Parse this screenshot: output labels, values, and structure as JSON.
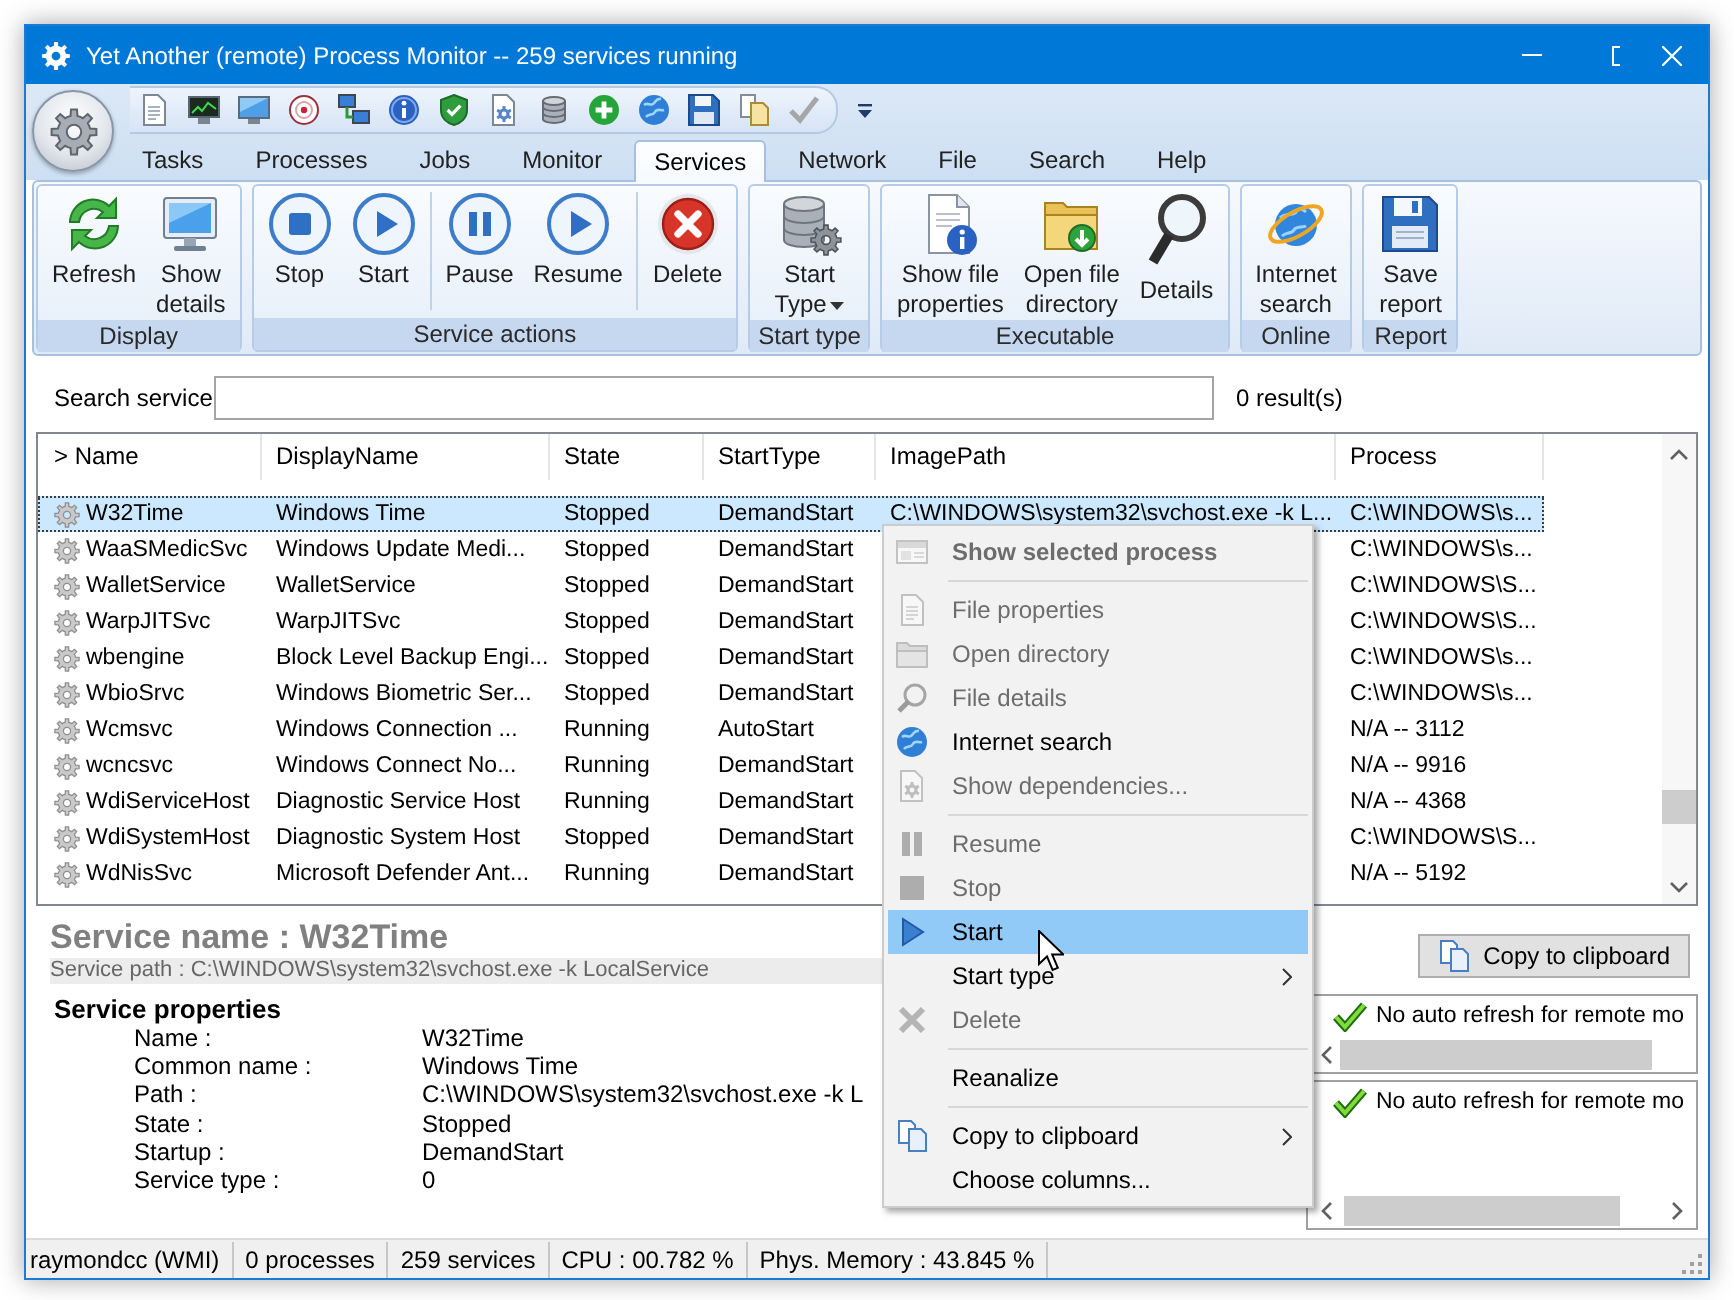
{
  "window": {
    "title": "Yet Another (remote) Process Monitor -- 259 services running"
  },
  "ribbon": {
    "tabs": [
      {
        "label": "Tasks",
        "selected": false
      },
      {
        "label": "Processes",
        "selected": false
      },
      {
        "label": "Jobs",
        "selected": false
      },
      {
        "label": "Monitor",
        "selected": false
      },
      {
        "label": "Services",
        "selected": true
      },
      {
        "label": "Network",
        "selected": false
      },
      {
        "label": "File",
        "selected": false
      },
      {
        "label": "Search",
        "selected": false
      },
      {
        "label": "Help",
        "selected": false
      }
    ],
    "groups": [
      {
        "label": "Display",
        "sections": [
          {
            "buttons": [
              {
                "label": "Refresh",
                "dropdown": false
              },
              {
                "label": "Show\ndetails",
                "dropdown": false
              }
            ]
          }
        ]
      },
      {
        "label": "Service actions",
        "sections": [
          {
            "buttons": [
              {
                "label": "Stop",
                "dropdown": false
              },
              {
                "label": "Start",
                "dropdown": false
              }
            ]
          },
          {
            "buttons": [
              {
                "label": "Pause",
                "dropdown": false
              },
              {
                "label": "Resume",
                "dropdown": false
              }
            ]
          },
          {
            "buttons": [
              {
                "label": "Delete",
                "dropdown": false
              }
            ]
          }
        ]
      },
      {
        "label": "Start type",
        "sections": [
          {
            "buttons": [
              {
                "label": "Start\nType",
                "dropdown": true
              }
            ]
          }
        ]
      },
      {
        "label": "Executable",
        "sections": [
          {
            "buttons": [
              {
                "label": "Show file\nproperties",
                "dropdown": false
              },
              {
                "label": "Open file\ndirectory",
                "dropdown": false
              },
              {
                "label": "Details",
                "dropdown": false
              }
            ]
          }
        ]
      },
      {
        "label": "Online",
        "sections": [
          {
            "buttons": [
              {
                "label": "Internet\nsearch",
                "dropdown": false
              }
            ]
          }
        ]
      },
      {
        "label": "Report",
        "sections": [
          {
            "buttons": [
              {
                "label": "Save\nreport",
                "dropdown": false
              }
            ]
          }
        ]
      }
    ]
  },
  "search": {
    "label": "Search service",
    "result_count": "0 result(s)"
  },
  "table": {
    "columns": [
      "> Name",
      "DisplayName",
      "State",
      "StartType",
      "ImagePath",
      "Process"
    ],
    "rows": [
      {
        "name": "W32Time",
        "display_name": "Windows Time",
        "state": "Stopped",
        "start_type": "DemandStart",
        "image_path": "C:\\WINDOWS\\system32\\svchost.exe -k L...",
        "process": "C:\\WINDOWS\\s...",
        "selected": true
      },
      {
        "name": "WaaSMedicSvc",
        "display_name": "Windows Update Medi...",
        "state": "Stopped",
        "start_type": "DemandStart",
        "process": "C:\\WINDOWS\\s...",
        "selected": false
      },
      {
        "name": "WalletService",
        "display_name": "WalletService",
        "state": "Stopped",
        "start_type": "DemandStart",
        "process": "C:\\WINDOWS\\S...",
        "selected": false
      },
      {
        "name": "WarpJITSvc",
        "display_name": "WarpJITSvc",
        "state": "Stopped",
        "start_type": "DemandStart",
        "process": "C:\\WINDOWS\\S...",
        "selected": false
      },
      {
        "name": "wbengine",
        "display_name": "Block Level Backup Engi...",
        "state": "Stopped",
        "start_type": "DemandStart",
        "process": "C:\\WINDOWS\\s...",
        "selected": false
      },
      {
        "name": "WbioSrvc",
        "display_name": "Windows Biometric Ser...",
        "state": "Stopped",
        "start_type": "DemandStart",
        "process": "C:\\WINDOWS\\s...",
        "selected": false
      },
      {
        "name": "Wcmsvc",
        "display_name": "Windows Connection ...",
        "state": "Running",
        "start_type": "AutoStart",
        "process": "N/A -- 3112",
        "selected": false
      },
      {
        "name": "wcncsvc",
        "display_name": "Windows Connect No...",
        "state": "Running",
        "start_type": "DemandStart",
        "process": "N/A -- 9916",
        "selected": false
      },
      {
        "name": "WdiServiceHost",
        "display_name": "Diagnostic Service Host",
        "state": "Running",
        "start_type": "DemandStart",
        "process": "N/A -- 4368",
        "selected": false
      },
      {
        "name": "WdiSystemHost",
        "display_name": "Diagnostic System Host",
        "state": "Stopped",
        "start_type": "DemandStart",
        "process": "C:\\WINDOWS\\S...",
        "selected": false
      },
      {
        "name": "WdNisSvc",
        "display_name": "Microsoft Defender Ant...",
        "state": "Running",
        "start_type": "DemandStart",
        "process": "N/A -- 5192",
        "selected": false
      }
    ]
  },
  "context_menu": {
    "sections": [
      {
        "items": [
          {
            "label": "Show selected process",
            "default": true,
            "disabled": true,
            "selected": false,
            "submenu": false
          }
        ]
      },
      {
        "items": [
          {
            "label": "File properties",
            "default": false,
            "disabled": true,
            "selected": false,
            "submenu": false
          },
          {
            "label": "Open directory",
            "default": false,
            "disabled": true,
            "selected": false,
            "submenu": false
          },
          {
            "label": "File details",
            "default": false,
            "disabled": true,
            "selected": false,
            "submenu": false
          },
          {
            "label": "Internet search",
            "default": false,
            "disabled": false,
            "selected": false,
            "submenu": false
          },
          {
            "label": "Show dependencies...",
            "default": false,
            "disabled": true,
            "selected": false,
            "submenu": false
          }
        ]
      },
      {
        "items": [
          {
            "label": "Resume",
            "default": false,
            "disabled": true,
            "selected": false,
            "submenu": false
          },
          {
            "label": "Stop",
            "default": false,
            "disabled": true,
            "selected": false,
            "submenu": false
          },
          {
            "label": "Start",
            "default": false,
            "disabled": false,
            "selected": true,
            "submenu": false
          },
          {
            "label": "Start type",
            "default": false,
            "disabled": false,
            "selected": false,
            "submenu": true
          },
          {
            "label": "Delete",
            "default": false,
            "disabled": true,
            "selected": false,
            "submenu": false
          }
        ]
      },
      {
        "items": [
          {
            "label": "Reanalize",
            "default": false,
            "disabled": false,
            "selected": false,
            "submenu": false
          }
        ]
      },
      {
        "items": [
          {
            "label": "Copy to clipboard",
            "default": false,
            "disabled": false,
            "selected": false,
            "submenu": true
          },
          {
            "label": "Choose columns...",
            "default": false,
            "disabled": false,
            "selected": false,
            "submenu": false
          }
        ]
      }
    ]
  },
  "details": {
    "title": "Service name : W32Time",
    "path": "Service path : C:\\WINDOWS\\system32\\svchost.exe -k LocalService",
    "section": "Service properties",
    "properties": [
      {
        "label": "Name :",
        "value": "W32Time"
      },
      {
        "label": "Common name :",
        "value": "Windows Time"
      },
      {
        "label": "Path :",
        "value": "C:\\WINDOWS\\system32\\svchost.exe -k L"
      },
      {
        "label": "State :",
        "value": "Stopped"
      },
      {
        "label": "Startup :",
        "value": "DemandStart"
      },
      {
        "label": "Service type :",
        "value": "0"
      }
    ]
  },
  "copy_button": {
    "label": "Copy to clipboard"
  },
  "log_panels": [
    {
      "messages": [
        "No auto refresh for remote mo"
      ]
    },
    {
      "messages": [
        "No auto refresh for remote mo"
      ]
    }
  ],
  "status_bar": {
    "items": [
      "raymondcc (WMI)",
      "0 processes",
      "259 services",
      "CPU : 00.782 %",
      "Phys. Memory : 43.845 %"
    ]
  }
}
